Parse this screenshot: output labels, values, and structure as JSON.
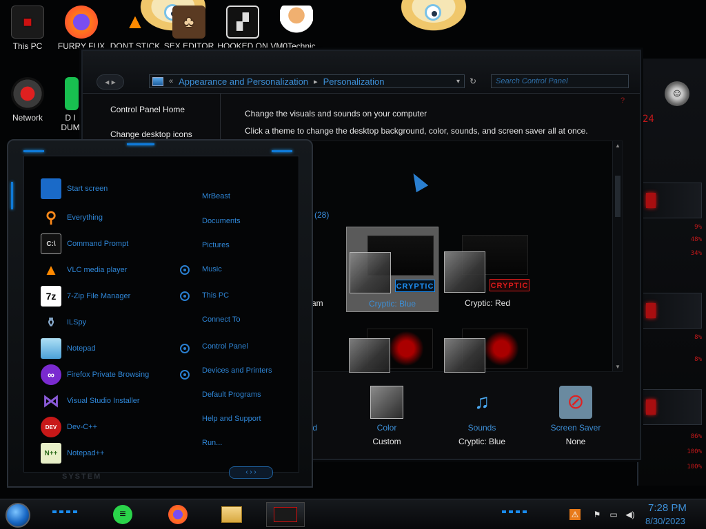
{
  "desktop": {
    "icons": [
      {
        "label": "This PC",
        "icon": "this-pc-icon"
      },
      {
        "label": "FURRY FUX",
        "icon": "firefox-icon"
      },
      {
        "label": "DONT STICK",
        "icon": "vlc-cone-icon"
      },
      {
        "label": "SEX EDITOR",
        "icon": "game-icon"
      },
      {
        "label": "HOOKED ON",
        "icon": "maze-icon"
      },
      {
        "label": "VM0Technic...",
        "icon": "doctor-icon"
      },
      {
        "label": "Network",
        "icon": "network-icon"
      },
      {
        "label": "D I DUM",
        "icon": "green-file-icon"
      }
    ]
  },
  "control_panel": {
    "breadcrumb": [
      "Appearance and Personalization",
      "Personalization"
    ],
    "breadcrumb_prefix": "«",
    "search_placeholder": "Search Control Panel",
    "sidebar_links": [
      "Control Panel Home",
      "Change desktop icons"
    ],
    "heading": "Change the visuals and sounds on your computer",
    "subheading": "Click a theme to change the desktop background, color, sounds, and screen saver all at once.",
    "themes_count": "(28)",
    "partial_theme_label": "am",
    "themes": [
      {
        "name": "Cryptic: Blue",
        "badge": "CRYPTIC",
        "accent": "#1c8cf0",
        "selected": true
      },
      {
        "name": "Cryptic: Red",
        "badge": "CRYPTIC",
        "accent": "#d81a1a",
        "selected": false
      }
    ],
    "bottom": [
      {
        "link": "und",
        "value": ""
      },
      {
        "link": "Color",
        "value": "Custom"
      },
      {
        "link": "Sounds",
        "value": "Cryptic: Blue"
      },
      {
        "link": "Screen Saver",
        "value": "None"
      }
    ]
  },
  "start_menu": {
    "programs": [
      {
        "label": "Start screen",
        "icon": "start-screen-icon",
        "pin": false
      },
      {
        "label": "Everything",
        "icon": "magnifier-icon",
        "pin": false
      },
      {
        "label": "Command Prompt",
        "icon": "cmd-icon",
        "pin": false
      },
      {
        "label": "VLC media player",
        "icon": "vlc-icon",
        "pin": true
      },
      {
        "label": "7-Zip File Manager",
        "icon": "7zip-icon",
        "pin": true
      },
      {
        "label": "ILSpy",
        "icon": "ilspy-icon",
        "pin": false
      },
      {
        "label": "Notepad",
        "icon": "notepad-icon",
        "pin": true
      },
      {
        "label": "Firefox Private Browsing",
        "icon": "firefox-private-icon",
        "pin": true
      },
      {
        "label": "Visual Studio Installer",
        "icon": "vs-installer-icon",
        "pin": false
      },
      {
        "label": "Dev-C++",
        "icon": "devcpp-icon",
        "pin": false
      },
      {
        "label": "Notepad++",
        "icon": "notepadpp-icon",
        "pin": false
      }
    ],
    "places": [
      "MrBeast",
      "Documents",
      "Pictures",
      "Music",
      "This PC",
      "Connect To",
      "Control Panel",
      "Devices and Printers",
      "Default Programs",
      "Help and Support",
      "Run..."
    ],
    "nav": "‹ › ›",
    "system_label": "SYSTEM"
  },
  "right_hud": {
    "values": [
      "24",
      "9%",
      "48%",
      "34%",
      "8%",
      "8%",
      "86%",
      "100%",
      "100%"
    ]
  },
  "taskbar": {
    "apps": [
      "notes-app-icon",
      "firefox-icon",
      "file-explorer-icon",
      "alien-app-icon"
    ],
    "time": "7:28 PM",
    "date": "8/30/2023"
  }
}
